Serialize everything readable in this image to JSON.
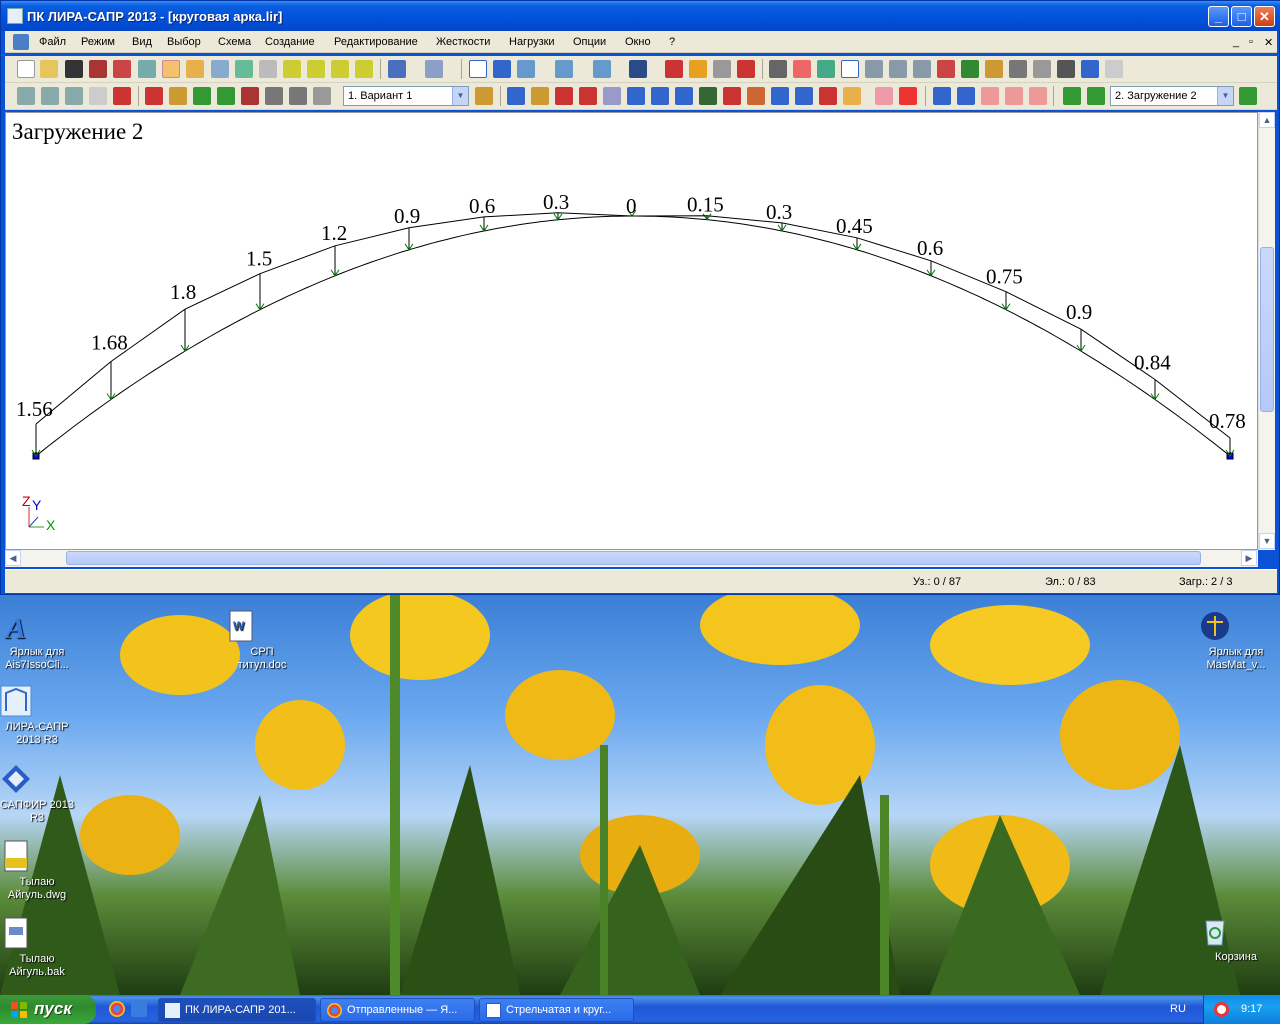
{
  "window": {
    "title": "ПК ЛИРА-САПР  2013 - [круговая арка.lir]",
    "controls": {
      "minimize": "_",
      "maximize": "□",
      "close": "✕"
    }
  },
  "menu": {
    "items": [
      "Файл",
      "Режим",
      "Вид",
      "Выбор",
      "Схема",
      "Создание",
      "Редактирование",
      "Жесткости",
      "Нагрузки",
      "Опции",
      "Окно",
      "?"
    ],
    "mdi_controls": {
      "minimize": "_",
      "restore": "▫",
      "close": "✕"
    }
  },
  "toolbar": {
    "variant_combo": "1. Вариант 1",
    "loadcase_combo": "2. Загружение 2"
  },
  "canvas": {
    "title": "Загружение 2",
    "axis": {
      "z": "Z",
      "y": "Y",
      "x": "X"
    },
    "load_labels": [
      "1.56",
      "1.68",
      "1.8",
      "1.5",
      "1.2",
      "0.9",
      "0.6",
      "0.3",
      "0",
      "0.15",
      "0.3",
      "0.45",
      "0.6",
      "0.75",
      "0.9",
      "0.84",
      "0.78"
    ]
  },
  "status": {
    "nodes": "Уз.: 0 / 87",
    "elements": "Эл.: 0 / 83",
    "loads": "Загр.: 2 / 3"
  },
  "desktop": {
    "icons": [
      {
        "label": "Ярлык для Ais7IssoCli...",
        "icon": "shortcut-a-icon"
      },
      {
        "label": "СРП титул.doc",
        "icon": "word-document-icon"
      },
      {
        "label": "ЛИРА-САПР 2013 R3",
        "icon": "lira-sapr-icon"
      },
      {
        "label": "САПФИР 2013 R3",
        "icon": "sapfir-icon"
      },
      {
        "label": "Тылаю Айгуль.dwg",
        "icon": "dwg-file-icon"
      },
      {
        "label": "Тылаю Айгуль.bak",
        "icon": "bak-file-icon"
      },
      {
        "label": "Ярлык для MasMat_v...",
        "icon": "scales-icon"
      },
      {
        "label": "Корзина",
        "icon": "recycle-bin-icon"
      }
    ]
  },
  "taskbar": {
    "start": "пуск",
    "buttons": [
      "ПК ЛИРА-САПР 201...",
      "Отправленные — Я...",
      "Стрельчатая и круг..."
    ],
    "language": "RU",
    "time": "9:17"
  },
  "colors": {
    "titlebar": "#0050dc",
    "chrome": "#ece9d8",
    "load_arrow": "#008000",
    "node": "#0000ff",
    "taskbar": "#2157d7",
    "start": "#3aa83a"
  }
}
